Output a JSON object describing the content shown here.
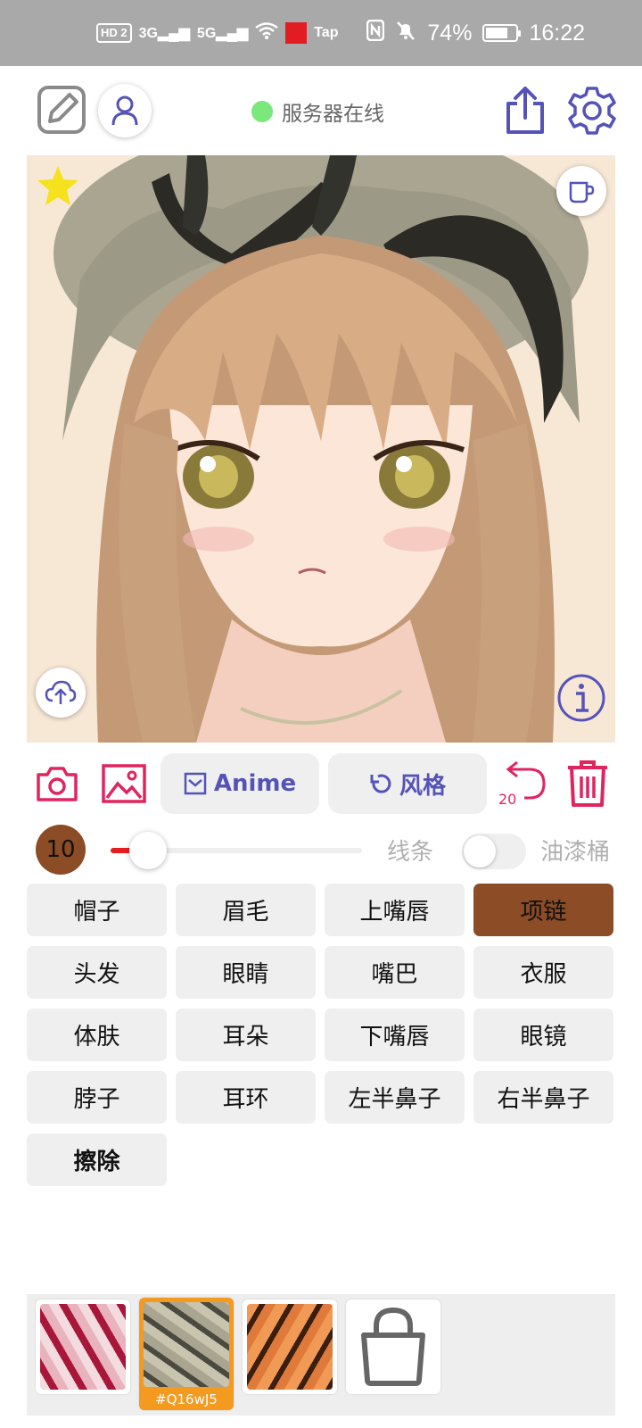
{
  "status_bar": {
    "network_left": "HD 2",
    "signal1": "3G",
    "signal2": "5G",
    "tap_label": "Tap",
    "battery_percent": "74%",
    "battery_level": 0.74,
    "time": "16:22"
  },
  "header": {
    "server_status": "服务器在线",
    "status_color": "#7ae87a"
  },
  "toolbar": {
    "anime_label": "Anime",
    "style_label": "风格",
    "undo_count": "20",
    "accent_color": "#e0245e",
    "button_text_color": "#5553b7"
  },
  "brush": {
    "size": "10",
    "slider_fraction": 0.1,
    "line_label": "线条",
    "bucket_label": "油漆桶",
    "bucket_enabled": false
  },
  "parts": [
    {
      "label": "帽子",
      "active": false
    },
    {
      "label": "眉毛",
      "active": false
    },
    {
      "label": "上嘴唇",
      "active": false
    },
    {
      "label": "项链",
      "active": true
    },
    {
      "label": "头发",
      "active": false
    },
    {
      "label": "眼睛",
      "active": false
    },
    {
      "label": "嘴巴",
      "active": false
    },
    {
      "label": "衣服",
      "active": false
    },
    {
      "label": "体肤",
      "active": false
    },
    {
      "label": "耳朵",
      "active": false
    },
    {
      "label": "下嘴唇",
      "active": false
    },
    {
      "label": "眼镜",
      "active": false
    },
    {
      "label": "脖子",
      "active": false
    },
    {
      "label": "耳环",
      "active": false
    },
    {
      "label": "左半鼻子",
      "active": false
    },
    {
      "label": "右半鼻子",
      "active": false
    },
    {
      "label": "擦除",
      "active": false
    }
  ],
  "palette": {
    "selected_label": "#Q16wJ5",
    "selected_color": "#f39a1f"
  }
}
